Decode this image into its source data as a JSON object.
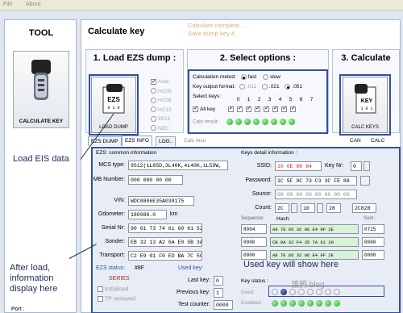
{
  "menu": {
    "file": "File",
    "about": "About"
  },
  "tool": {
    "title": "TOOL",
    "calc_key_label": "CALCULATE KEY",
    "port_label": "Port :"
  },
  "main": {
    "title": "Calculate key",
    "status_line1": "Calculate complete ...",
    "status_line2": "Save dump key 4"
  },
  "section1": {
    "title": "1. Load EZS dump :",
    "load_dump_label": "LOAD DUMP",
    "auto_label": "Auto:",
    "chips": [
      "HC05",
      "HC08",
      "HC12",
      "9S12",
      "NEC"
    ]
  },
  "section2": {
    "title": "2. Select options :",
    "calc_method_label": "Calculation metod:",
    "fast": "fast",
    "slow": "slow",
    "key_output_label": "Key output format:",
    "fmt_011": ".011",
    "fmt_021": ".021",
    "fmt_051": ".051",
    "select_keys_label": "Select keys:",
    "all_key_label": "All key",
    "key_numbers": [
      "0",
      "1",
      "2",
      "3",
      "4",
      "5",
      "6",
      "7"
    ],
    "calc_result_label": "Calc result:"
  },
  "section3": {
    "title": "3. Calculate",
    "calc_keys_label": "CALC KEYS"
  },
  "tabs": [
    "EZS DUMP",
    "EZS INFO",
    "LOG..",
    "Calc resu",
    "CAN",
    "CALC"
  ],
  "ezs_info": {
    "header": "EZS: common information",
    "mcs_type_label": "MCS type:",
    "mcs_type_value": "9S12(1L8SD,3L40K,4L40K,1L59W,",
    "mb_number_label": "MB Number:",
    "mb_number_value": "000 000 00 00",
    "vin_label": "VIN:",
    "vin_value": "WDC8886E35A038175",
    "odometer_label": "Odometer:",
    "odometer_value": "180986.0",
    "odometer_unit": "km",
    "serial_label": "Serial Nr:",
    "serial_value": "90 01 73 74 61 60 61 52",
    "sonder_label": "Sonder:",
    "sonder_value": "EB 32 13 A2 6A E0 5B 3A",
    "transport_label": "Transport:",
    "transport_value": "C2 E9 01 F0 ED BA 7C 5C",
    "ezs_status_label": "EZS status:",
    "ezs_status_value": "#8F",
    "series_label": "SERIES",
    "initialised_label": "Initialised",
    "tp_removed_label": "TP removed",
    "used_key_label": "Used key:",
    "last_key_label": "Last key:",
    "last_key_value": "0",
    "previous_key_label": "Previous key:",
    "previous_key_value": "1",
    "test_counter_label": "Test counter:",
    "test_counter_value": "0000"
  },
  "keys_detail": {
    "header": "Keys detail information :",
    "ssid_label": "SSID:",
    "ssid_value": "10 0E 88 84",
    "key_nr_label": "Key Nr:",
    "key_nr_value": "0",
    "password_label": "Password:",
    "password_value": "1C 5F 9C 73 C3 3C FE 88",
    "source_label": "Source:",
    "source_value": "00 00 00 00 00 00 00 00",
    "count_label": "Count:",
    "count_values": [
      "2C",
      "10",
      "28",
      "2C828"
    ],
    "sequence_label": "Sequence:",
    "hash_label": "Hash:",
    "sum_label": "Sum:",
    "hash_rows": [
      {
        "seq": "8004",
        "hash": "A8 7E 66 32 06 E4 9F 2E",
        "sum": "0725"
      },
      {
        "seq": "0000",
        "hash": "CB 9A 32 F4 35 7A 61 20",
        "sum": "0000"
      },
      {
        "seq": "0000",
        "hash": "A8 7E 66 32 06 E4 9F 2E",
        "sum": "0000"
      }
    ],
    "key_status_label": "Key status :",
    "used_row_label": "Used:",
    "enabled_row_label": "Enabled:"
  },
  "annotations": {
    "load_eis": "Load EIS data",
    "after_load_1": "After load,",
    "after_load_2": "information",
    "after_load_3": "display here",
    "used_key": "Used key will show here"
  },
  "watermark": "渡鸦 blog"
}
